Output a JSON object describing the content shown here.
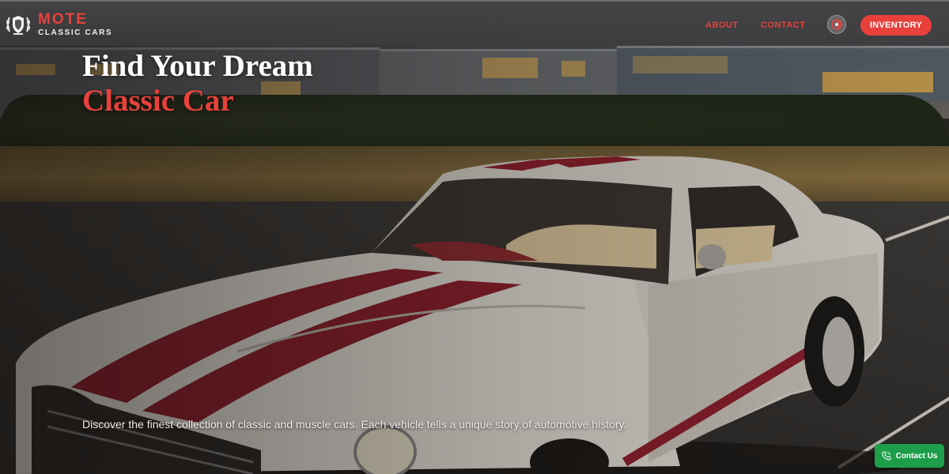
{
  "brand": {
    "name": "MOTE",
    "subtitle": "CLASSIC CARS",
    "accent_color": "#e8413c"
  },
  "nav": {
    "about_label": "ABOUT",
    "contact_label": "CONTACT",
    "theme_toggle_icon": "theme-toggle-icon",
    "inventory_label": "INVENTORY"
  },
  "hero": {
    "title_line1": "Find Your Dream",
    "title_line2": "Classic Car",
    "description": "Discover the finest collection of classic and muscle cars. Each vehicle tells a unique story of automotive history.",
    "background_image": "white Mustang with red racing stripes parked in front of apartment buildings at dusk"
  },
  "contact_fab": {
    "label": "Contact Us",
    "icon": "phone-icon",
    "color": "#1e9e4a"
  }
}
